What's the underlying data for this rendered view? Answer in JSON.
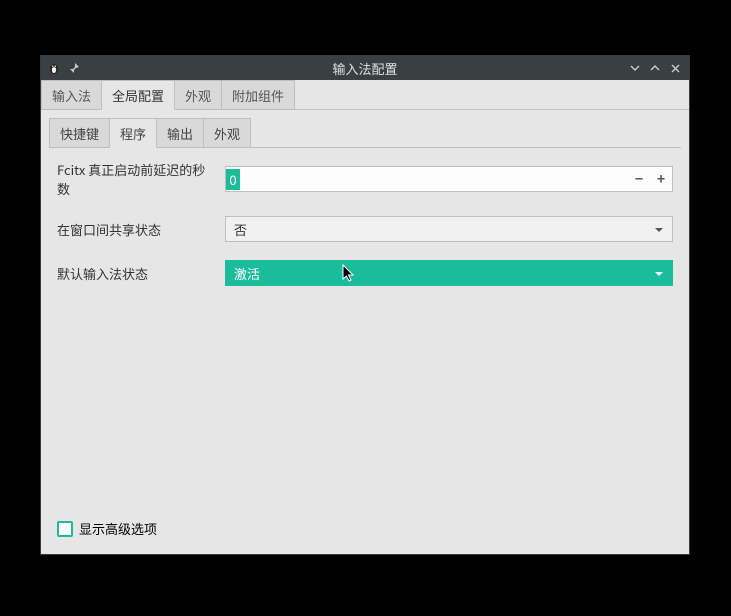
{
  "window": {
    "title": "输入法配置"
  },
  "tabs": {
    "items": [
      {
        "label": "输入法"
      },
      {
        "label": "全局配置"
      },
      {
        "label": "外观"
      },
      {
        "label": "附加组件"
      }
    ]
  },
  "subtabs": {
    "items": [
      {
        "label": "快捷键"
      },
      {
        "label": "程序"
      },
      {
        "label": "输出"
      },
      {
        "label": "外观"
      }
    ]
  },
  "form": {
    "row1": {
      "label": "Fcitx 真正启动前延迟的秒数",
      "value": "0"
    },
    "row2": {
      "label": "在窗口间共享状态",
      "value": "否"
    },
    "row3": {
      "label": "默认输入法状态",
      "value": "激活"
    }
  },
  "footer": {
    "checkbox_label": "显示高级选项"
  }
}
